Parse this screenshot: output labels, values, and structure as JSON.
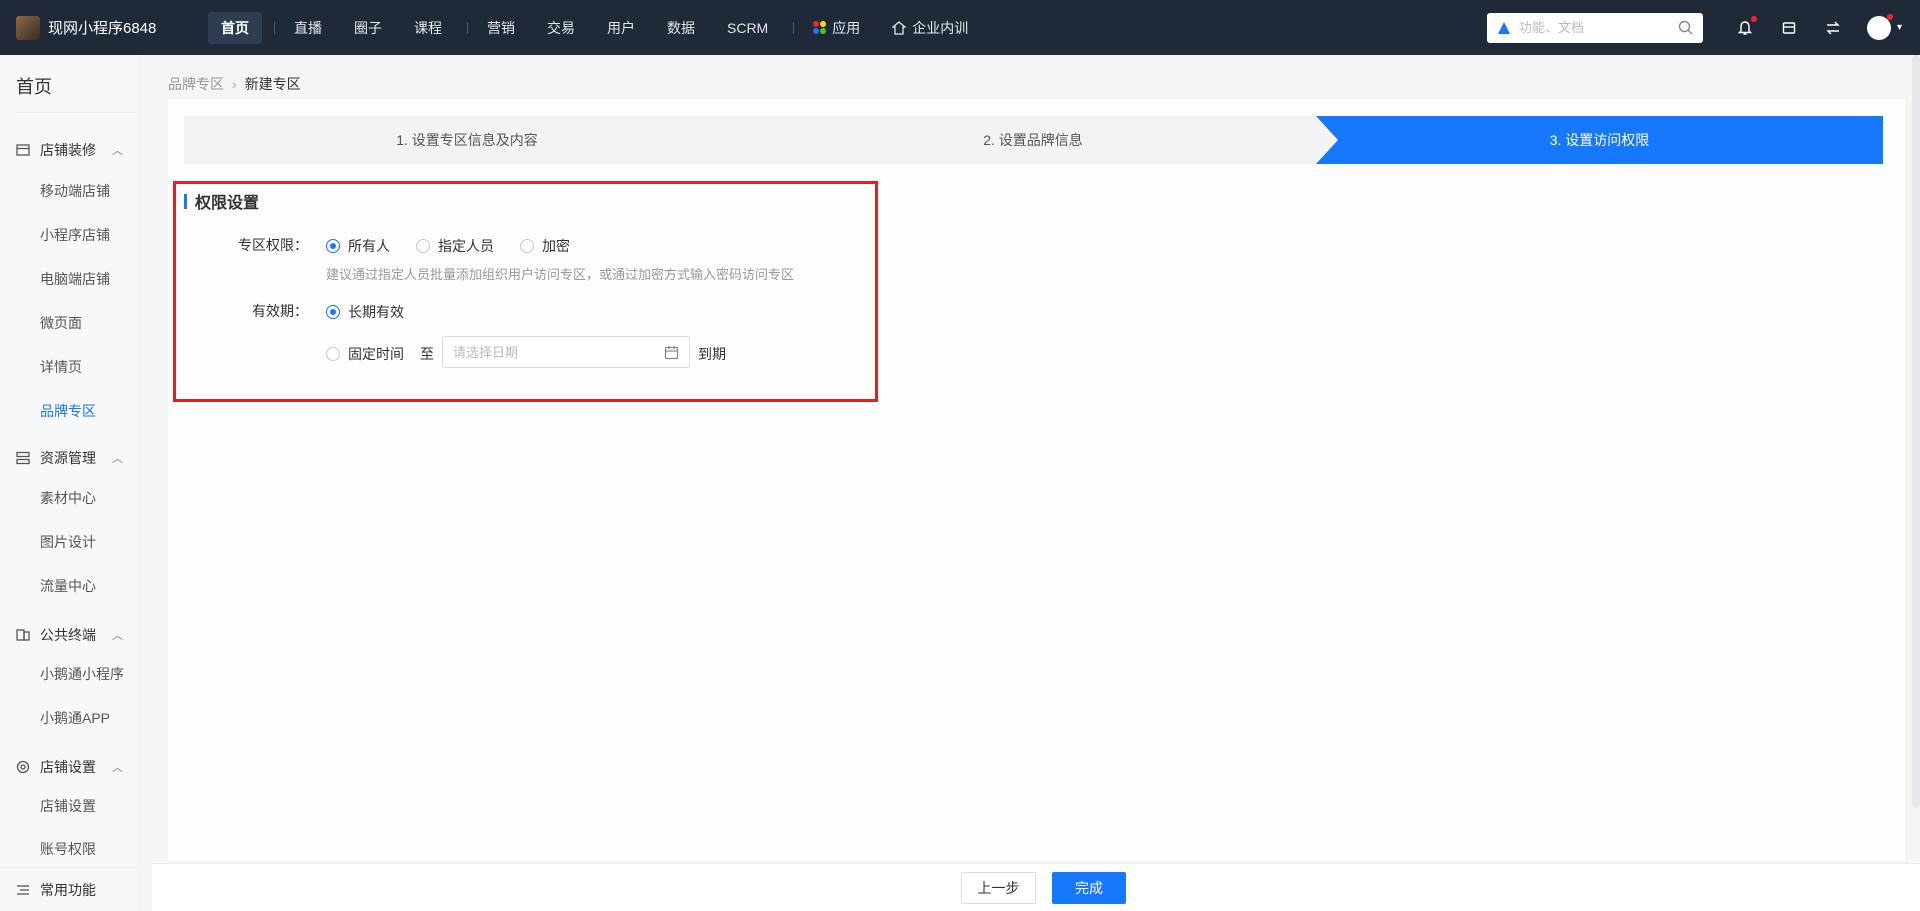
{
  "topnav": {
    "brand": "现网小程序6848",
    "items": [
      {
        "label": "首页",
        "active": true
      },
      {
        "label": "直播"
      },
      {
        "label": "圈子"
      },
      {
        "label": "课程"
      },
      {
        "label": "营销"
      },
      {
        "label": "交易"
      },
      {
        "label": "用户"
      },
      {
        "label": "数据"
      },
      {
        "label": "SCRM"
      },
      {
        "label": "应用"
      },
      {
        "label": "企业内训"
      }
    ],
    "search_placeholder": "功能、文档",
    "icons": [
      "bell-icon",
      "store-icon",
      "switch-icon",
      "avatar"
    ]
  },
  "sidebar": {
    "title": "首页",
    "groups": [
      {
        "label": "店铺装修",
        "icon": "store-icon",
        "items": [
          "移动端店铺",
          "小程序店铺",
          "电脑端店铺",
          "微页面",
          "详情页",
          "品牌专区"
        ]
      },
      {
        "label": "资源管理",
        "icon": "resource-icon",
        "items": [
          "素材中心",
          "图片设计",
          "流量中心"
        ]
      },
      {
        "label": "公共终端",
        "icon": "terminal-icon",
        "items": [
          "小鹅通小程序",
          "小鹅通APP"
        ]
      },
      {
        "label": "店铺设置",
        "icon": "gear-icon",
        "items": [
          "店铺设置",
          "账号权限"
        ]
      }
    ],
    "active_item": "品牌专区",
    "bottom": "常用功能"
  },
  "breadcrumb": {
    "parent": "品牌专区",
    "current": "新建专区"
  },
  "steps": [
    "1. 设置专区信息及内容",
    "2. 设置品牌信息",
    "3. 设置访问权限"
  ],
  "active_step": 3,
  "section": {
    "title": "权限设置",
    "permission": {
      "label": "专区权限：",
      "options": [
        "所有人",
        "指定人员",
        "加密"
      ],
      "selected": "所有人",
      "hint": "建议通过指定人员批量添加组织用户访问专区，或通过加密方式输入密码访问专区"
    },
    "validity": {
      "label": "有效期：",
      "options": [
        "长期有效",
        "固定时间"
      ],
      "selected": "长期有效",
      "to_label": "至",
      "date_placeholder": "请选择日期",
      "expire_label": "到期"
    }
  },
  "footer": {
    "prev_label": "上一步",
    "done_label": "完成"
  },
  "colors": {
    "accent": "#1677ff",
    "topbar": "#1f2937",
    "highlight": "#e02020"
  }
}
